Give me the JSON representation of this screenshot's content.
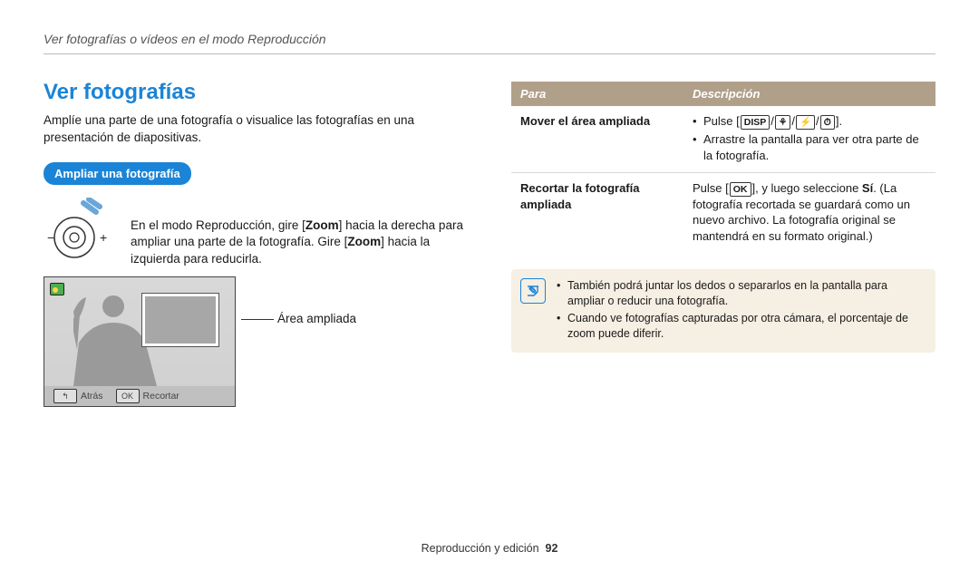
{
  "header": "Ver fotografías o vídeos en el modo Reproducción",
  "left": {
    "title": "Ver fotografías",
    "intro": "Amplíe una parte de una fotografía o visualice las fotografías en una presentación de diapositivas.",
    "pill": "Ampliar una fotografía",
    "zoom_text_pre": "En el modo Reproducción, gire [",
    "zoom_word1": "Zoom",
    "zoom_text_mid": "] hacia la derecha para ampliar una parte de la fotografía. Gire [",
    "zoom_word2": "Zoom",
    "zoom_text_post": "] hacia la izquierda para reducirla.",
    "area_label": "Área ampliada",
    "screen_back_key": "↰",
    "screen_back_label": "Atrás",
    "screen_ok_key": "OK",
    "screen_ok_label": "Recortar"
  },
  "right": {
    "th1": "Para",
    "th2": "Descripción",
    "row1_left": "Mover el área ampliada",
    "row1_bullet1_pre": "Pulse [",
    "row1_bullet1_glyph": "DISP",
    "row1_bullet1_sep1": "/",
    "row1_bullet1_icon1": "⚘",
    "row1_bullet1_sep2": "/",
    "row1_bullet1_icon2": "⚡",
    "row1_bullet1_sep3": "/",
    "row1_bullet1_icon3": "⏱",
    "row1_bullet1_post": "].",
    "row1_bullet2": "Arrastre la pantalla para ver otra parte de la fotografía.",
    "row2_left": "Recortar la fotografía ampliada",
    "row2_text_pre": "Pulse [",
    "row2_glyph": "OK",
    "row2_text_mid": "], y luego seleccione ",
    "row2_bold": "Sí",
    "row2_text_post": ". (La fotografía recortada se guardará como un nuevo archivo. La fotografía original se mantendrá en su formato original.)",
    "note1": "También podrá juntar los dedos o separarlos en la pantalla para ampliar o reducir una fotografía.",
    "note2": "Cuando ve fotografías capturadas por otra cámara, el porcentaje de zoom puede diferir."
  },
  "footer": {
    "label": "Reproducción y edición",
    "page": "92"
  }
}
